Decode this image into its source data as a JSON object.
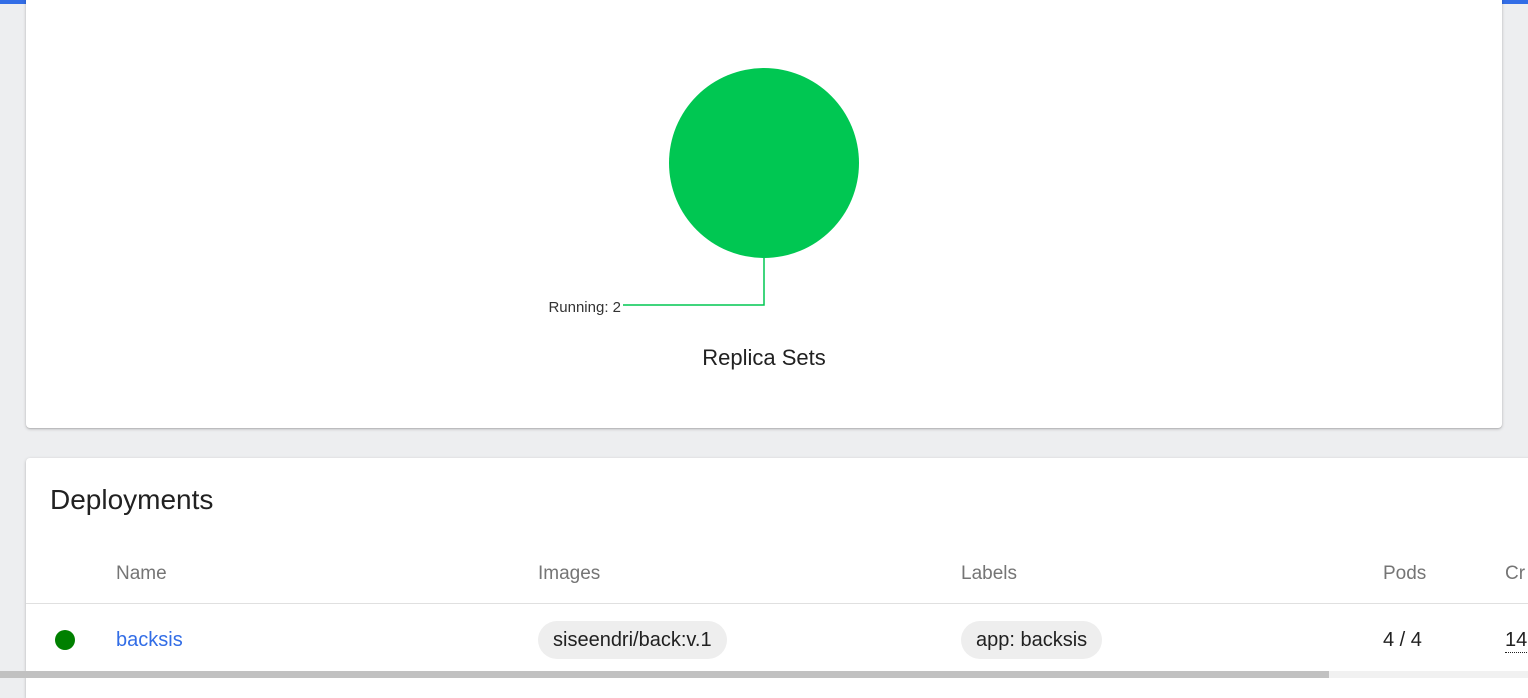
{
  "colors": {
    "accent": "#326de6",
    "running": "#00c752",
    "status_ok": "#008000",
    "chip_bg": "#eeeeee"
  },
  "replica_sets_chart": {
    "title": "Replica Sets",
    "chart_data": {
      "type": "pie",
      "title": "Replica Sets",
      "slices": [
        {
          "label": "Running",
          "value": 2,
          "color": "#00c752"
        }
      ],
      "legend_label": "Running: 2"
    }
  },
  "deployments": {
    "title": "Deployments",
    "columns": [
      "Name",
      "Images",
      "Labels",
      "Pods",
      "Cr"
    ],
    "rows": [
      {
        "status_icon": "check-circle-icon",
        "name": "backsis",
        "image": "siseendri/back:v.1",
        "label": "app: backsis",
        "pods": "4 / 4",
        "created": "14"
      }
    ]
  }
}
